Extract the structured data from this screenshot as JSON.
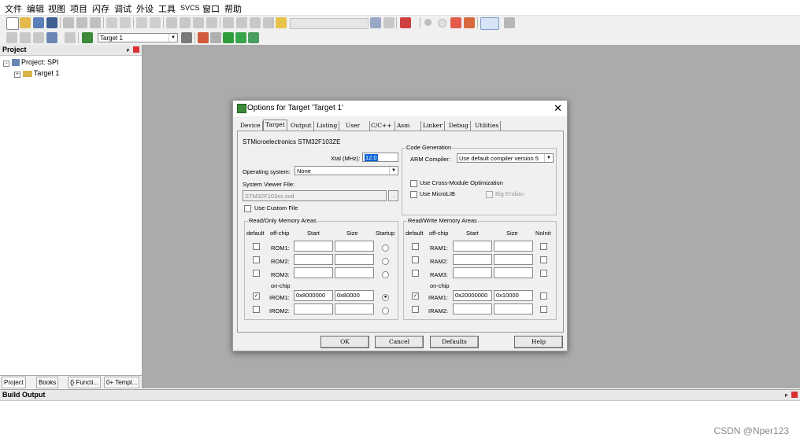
{
  "menu": [
    "文件",
    "编辑",
    "视图",
    "项目",
    "闪存",
    "调试",
    "外设",
    "工具",
    "SVCS",
    "窗口",
    "帮助"
  ],
  "toolbar2": {
    "target_select": "Target 1"
  },
  "project_panel": {
    "title": "Project",
    "root": "Project: SPI",
    "child": "Target 1",
    "tabs": [
      "Project",
      "Books",
      "{} Functi...",
      "0+ Templ..."
    ]
  },
  "build_output": {
    "title": "Build Output"
  },
  "watermark": "CSDN @Nper123",
  "dialog": {
    "title": "Options for Target 'Target 1'",
    "tabs": [
      "Device",
      "Target",
      "Output",
      "Listing",
      "User",
      "C/C++",
      "Asm",
      "Linker",
      "Debug",
      "Utilities"
    ],
    "selected_tab": "Target",
    "device_name": "STMicroelectronics STM32F103ZE",
    "xtal_label": "Xtal (MHz):",
    "xtal_value": "12.0",
    "os_label": "Operating system:",
    "os_value": "None",
    "svf_label": "System Viewer File:",
    "svf_value": "STM32F103xx.svd",
    "svf_browse": "...",
    "use_custom_file": "Use Custom File",
    "code_gen": {
      "title": "Code Generation",
      "arm_compiler_label": "ARM Compiler:",
      "arm_compiler_value": "Use default compiler version 5",
      "cross_module": "Use Cross-Module Optimization",
      "microlib": "Use MicroLIB",
      "big_endian": "Big Endian"
    },
    "rom_areas": {
      "title": "Read/Only Memory Areas",
      "headers": [
        "default",
        "off-chip",
        "Start",
        "Size",
        "Startup"
      ],
      "offchip": [
        {
          "name": "ROM1:",
          "start": "",
          "size": ""
        },
        {
          "name": "ROM2:",
          "start": "",
          "size": ""
        },
        {
          "name": "ROM3:",
          "start": "",
          "size": ""
        }
      ],
      "onchip_label": "on-chip",
      "onchip": [
        {
          "name": "IROM1:",
          "start": "0x8000000",
          "size": "0x80000",
          "default": true,
          "startup": true
        },
        {
          "name": "IROM2:",
          "start": "",
          "size": "",
          "default": false,
          "startup": false
        }
      ]
    },
    "ram_areas": {
      "title": "Read/Write Memory Areas",
      "headers": [
        "default",
        "off-chip",
        "Start",
        "Size",
        "NoInit"
      ],
      "offchip": [
        {
          "name": "RAM1:",
          "start": "",
          "size": ""
        },
        {
          "name": "RAM2:",
          "start": "",
          "size": ""
        },
        {
          "name": "RAM3:",
          "start": "",
          "size": ""
        }
      ],
      "onchip_label": "on-chip",
      "onchip": [
        {
          "name": "IRAM1:",
          "start": "0x20000000",
          "size": "0x10000",
          "default": true
        },
        {
          "name": "IRAM2:",
          "start": "",
          "size": "",
          "default": false
        }
      ]
    },
    "buttons": {
      "ok": "OK",
      "cancel": "Cancel",
      "defaults": "Defaults",
      "help": "Help"
    }
  },
  "colors": {
    "editor_bg": "#ababab",
    "selection": "#0a64d6",
    "close_red": "#d9322e"
  }
}
